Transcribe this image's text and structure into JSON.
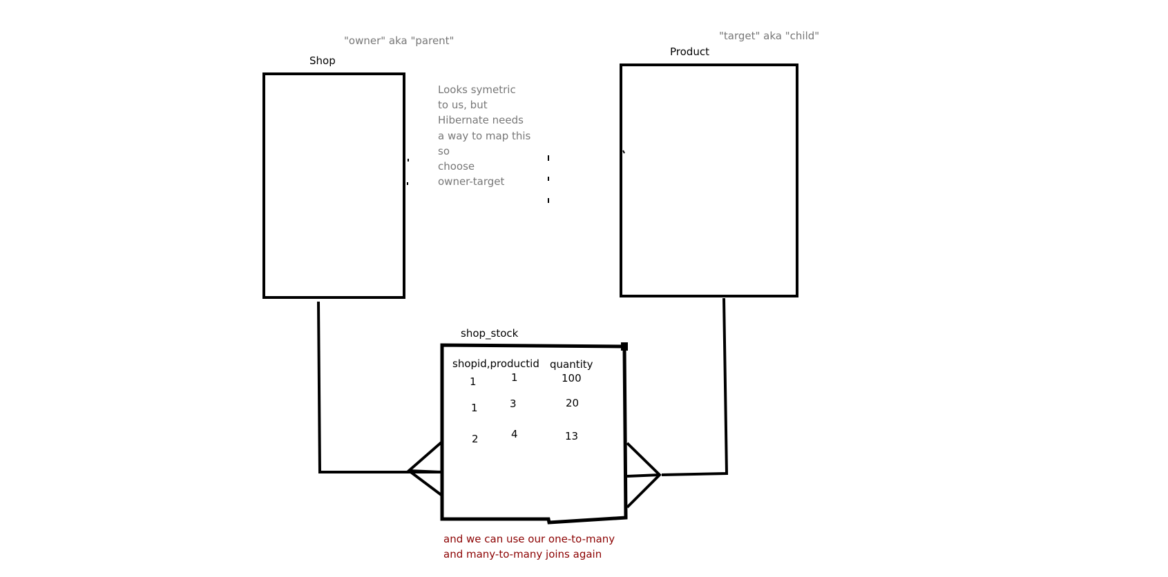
{
  "labels": {
    "owner_note": "\"owner\" aka \"parent\"",
    "target_note": "\"target\" aka \"child\"",
    "shop": "Shop",
    "product": "Product",
    "shop_stock": "shop_stock"
  },
  "middle_note": [
    "Looks symetric",
    "to us, but",
    "Hibernate needs",
    "a way to map this",
    "so",
    "choose",
    "owner-target"
  ],
  "table": {
    "headers": [
      "shopid,productid",
      "quantity"
    ],
    "rows": [
      {
        "shopid": "1",
        "productid": "1",
        "quantity": "100"
      },
      {
        "shopid": "1",
        "productid": "3",
        "quantity": "20"
      },
      {
        "shopid": "2",
        "productid": "4",
        "quantity": "13"
      }
    ]
  },
  "bottom_note": [
    "and we can use our one-to-many",
    "and many-to-many joins again"
  ],
  "colors": {
    "line": "#000000",
    "note": "#777777",
    "accent": "#8b0000"
  }
}
